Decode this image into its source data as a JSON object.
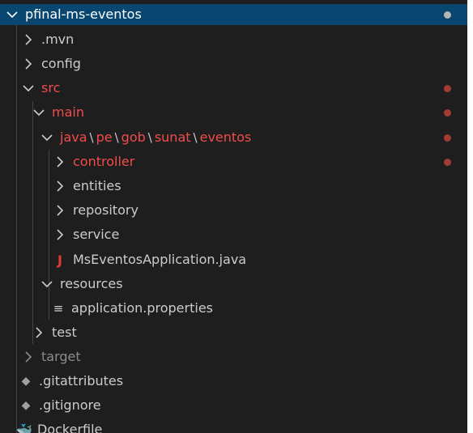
{
  "project": {
    "name": "pfinal-ms-eventos"
  },
  "tree": {
    "mvn": ".mvn",
    "config": "config",
    "src": "src",
    "main": "main",
    "java_path": {
      "java": "java",
      "pe": "pe",
      "gob": "gob",
      "sunat": "sunat",
      "eventos": "eventos",
      "separator": "\\"
    },
    "controller": "controller",
    "entities": "entities",
    "repository": "repository",
    "service": "service",
    "app_file": "MsEventosApplication.java",
    "resources": "resources",
    "properties_file": "application.properties",
    "test": "test",
    "target": "target",
    "gitattributes": ".gitattributes",
    "gitignore": ".gitignore",
    "dockerfile": "Dockerfile"
  },
  "icons": {
    "java_glyph": "J",
    "properties_glyph": "≡",
    "git_glyph": "◆",
    "docker_glyph": "🐳"
  },
  "colors": {
    "background": "#1e1e1e",
    "selection": "#094771",
    "modified_text": "#f14c4c",
    "modified_dot": "#a33c34",
    "ignored_text": "#8c8c8c"
  }
}
